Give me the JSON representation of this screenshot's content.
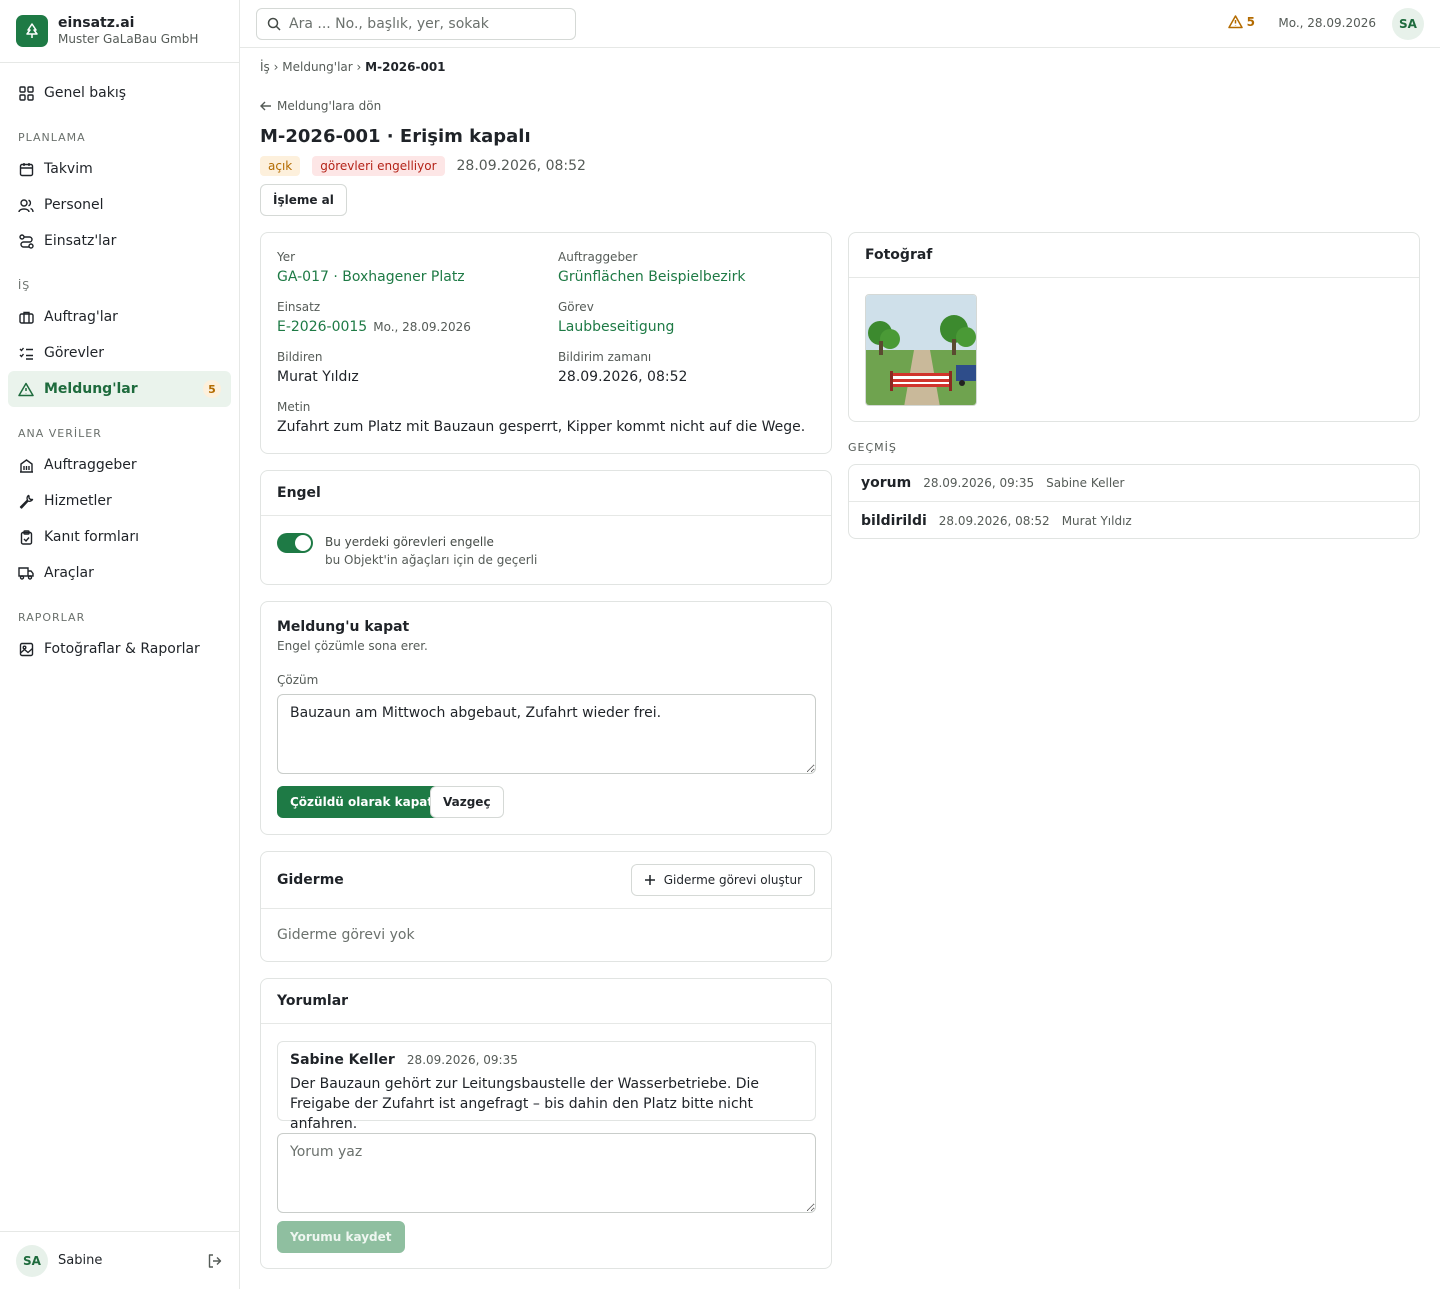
{
  "brand": {
    "name": "einsatz.ai",
    "company": "Muster GaLaBau GmbH"
  },
  "nav": {
    "overview": "Genel bakış",
    "sections": {
      "planning": "PLANLAMA",
      "work": "İŞ",
      "master": "ANA VERİLER",
      "reports": "RAPORLAR"
    },
    "calendar": "Takvim",
    "staff": "Personel",
    "deployments": "Einsatz'lar",
    "orders": "Auftrag'lar",
    "tasks": "Görevler",
    "reports_item": "Meldung'lar",
    "reports_badge": "5",
    "clients": "Auftraggeber",
    "services": "Hizmetler",
    "proof_forms": "Kanıt formları",
    "vehicles": "Araçlar",
    "photos_reports": "Fotoğraflar & Raporlar"
  },
  "user": {
    "initials": "SA",
    "name": "Sabine"
  },
  "topbar": {
    "search_placeholder": "Ara ... No., başlık, yer, sokak",
    "alert_count": "5",
    "date": "Mo., 28.09.2026",
    "initials": "SA"
  },
  "breadcrumb": {
    "part1": "İş",
    "sep": "›",
    "part2": "Meldung'lar",
    "current": "M-2026-001"
  },
  "back_label": "Meldung'lara dön",
  "title": "M-2026-001 · Erişim kapalı",
  "status_badge": "açık",
  "blocking_badge": "görevleri engelliyor",
  "created_at": "28.09.2026, 08:52",
  "take_button": "İşleme al",
  "details": {
    "location_label": "Yer",
    "location_value": "GA-017 · Boxhagener Platz",
    "client_label": "Auftraggeber",
    "client_value": "Grünflächen Beispielbezirk",
    "deployment_label": "Einsatz",
    "deployment_value": "E-2026-0015",
    "deployment_date": "Mo., 28.09.2026",
    "task_label": "Görev",
    "task_value": "Laubbeseitigung",
    "reporter_label": "Bildiren",
    "reporter_value": "Murat Yıldız",
    "reported_label": "Bildirim zamanı",
    "reported_value": "28.09.2026, 08:52",
    "text_label": "Metin",
    "text_value": "Zufahrt zum Platz mit Bauzaun gesperrt, Kipper kommt nicht auf die Wege."
  },
  "obstacle": {
    "title": "Engel",
    "toggle_on": true,
    "toggle_label": "Bu yerdeki görevleri engelle",
    "toggle_sub": "bu Objekt'in ağaçları için de geçerli"
  },
  "close": {
    "title": "Meldung'u kapat",
    "subtitle": "Engel çözümle sona erer.",
    "solution_label": "Çözüm",
    "solution_value": "Bauzaun am Mittwoch abgebaut, Zufahrt wieder frei.",
    "close_button": "Çözüldü olarak kapat",
    "cancel_button": "Vazgeç"
  },
  "remedy": {
    "title": "Giderme",
    "create_button": "Giderme görevi oluştur",
    "empty": "Giderme görevi yok"
  },
  "comments": {
    "title": "Yorumlar",
    "items": [
      {
        "author": "Sabine Keller",
        "date": "28.09.2026, 09:35",
        "text": "Der Bauzaun gehört zur Leitungsbaustelle der Wasserbetriebe. Die Freigabe der Zufahrt ist angefragt – bis dahin den Platz bitte nicht anfahren."
      }
    ],
    "placeholder": "Yorum yaz",
    "save_button": "Yorumu kaydet"
  },
  "photo": {
    "title": "Fotoğraf"
  },
  "history": {
    "title": "GEÇMİŞ",
    "items": [
      {
        "type": "yorum",
        "date": "28.09.2026, 09:35",
        "user": "Sabine Keller"
      },
      {
        "type": "bildirildi",
        "date": "28.09.2026, 08:52",
        "user": "Murat Yıldız"
      }
    ]
  },
  "colors": {
    "accent": "#1e7a45",
    "warning": "#b36b00",
    "danger": "#b42318",
    "active_bg": "#eaf3ec"
  }
}
